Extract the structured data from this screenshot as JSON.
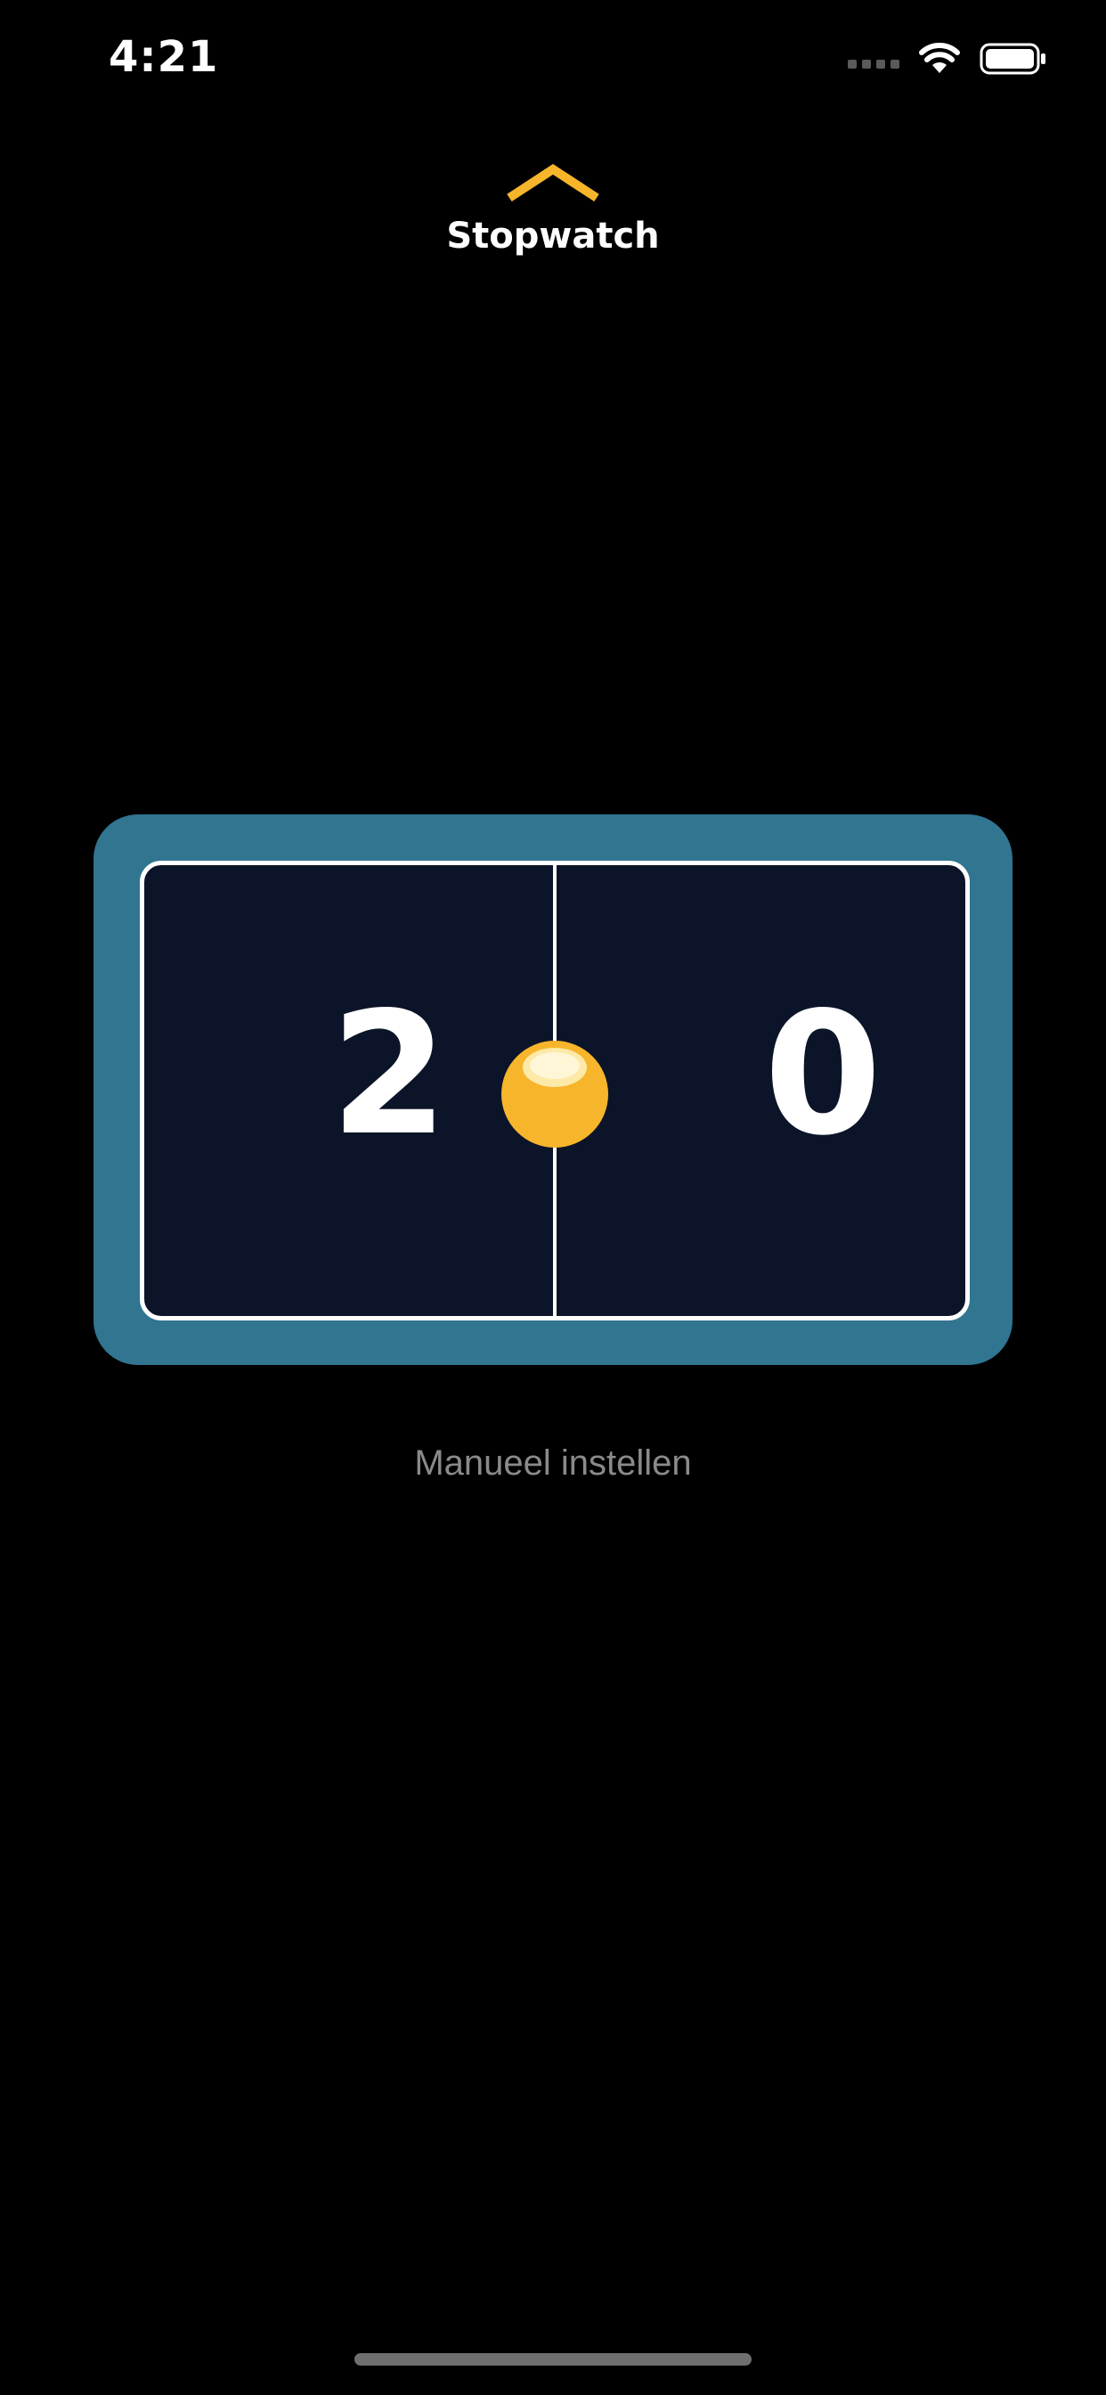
{
  "status_bar": {
    "time": "4:21",
    "icons": [
      "cellular-signal-icon",
      "wifi-icon",
      "battery-icon"
    ]
  },
  "header": {
    "icon": "chevron-up-icon",
    "title": "Stopwatch"
  },
  "scoreboard": {
    "left_score": "2",
    "right_score": "0",
    "serve_indicator_icon": "ball-icon",
    "colors": {
      "frame": "#317590",
      "court": "#0c1429",
      "lines": "#ffffff",
      "ball": "#f7b52c"
    }
  },
  "manual_link": {
    "label": "Manueel instellen"
  },
  "theme": {
    "accent": "#f7b52c",
    "background": "#000000",
    "muted_text": "#8a8a8a"
  }
}
